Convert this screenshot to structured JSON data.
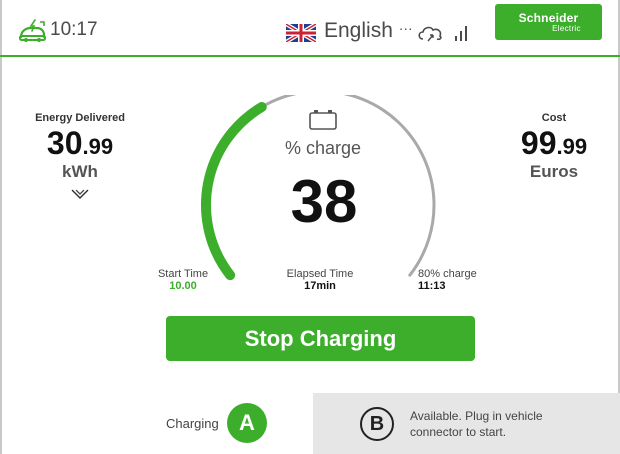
{
  "header": {
    "time": "10:17",
    "language": "English",
    "language_more": "···",
    "brand_name": "Schneider",
    "brand_sub": "Electric",
    "icons": [
      "ev-charger-icon",
      "uk-flag-icon",
      "cloud-icon",
      "signal-icon"
    ]
  },
  "energy": {
    "label": "Energy Delivered",
    "value_int": "30",
    "value_dec": ".99",
    "unit": "kWh"
  },
  "cost": {
    "label": "Cost",
    "value_int": "99",
    "value_dec": ".99",
    "unit": "Euros"
  },
  "charge": {
    "label": "% charge",
    "value": "38",
    "fraction": 0.38
  },
  "times": {
    "start_label": "Start Time",
    "start_value": "10.00",
    "elapsed_label": "Elapsed Time",
    "elapsed_value": "17min",
    "target_label": "80% charge",
    "target_value": "11:13"
  },
  "stop_button": "Stop Charging",
  "connectors": {
    "a": {
      "status": "Charging",
      "letter": "A"
    },
    "b": {
      "letter": "B",
      "line1": "Available. Plug in vehicle",
      "line2": "connector to start."
    }
  },
  "colors": {
    "accent": "#3dae2b",
    "arc_bg": "#a9a9a9",
    "panel": "#e6e6e6"
  }
}
